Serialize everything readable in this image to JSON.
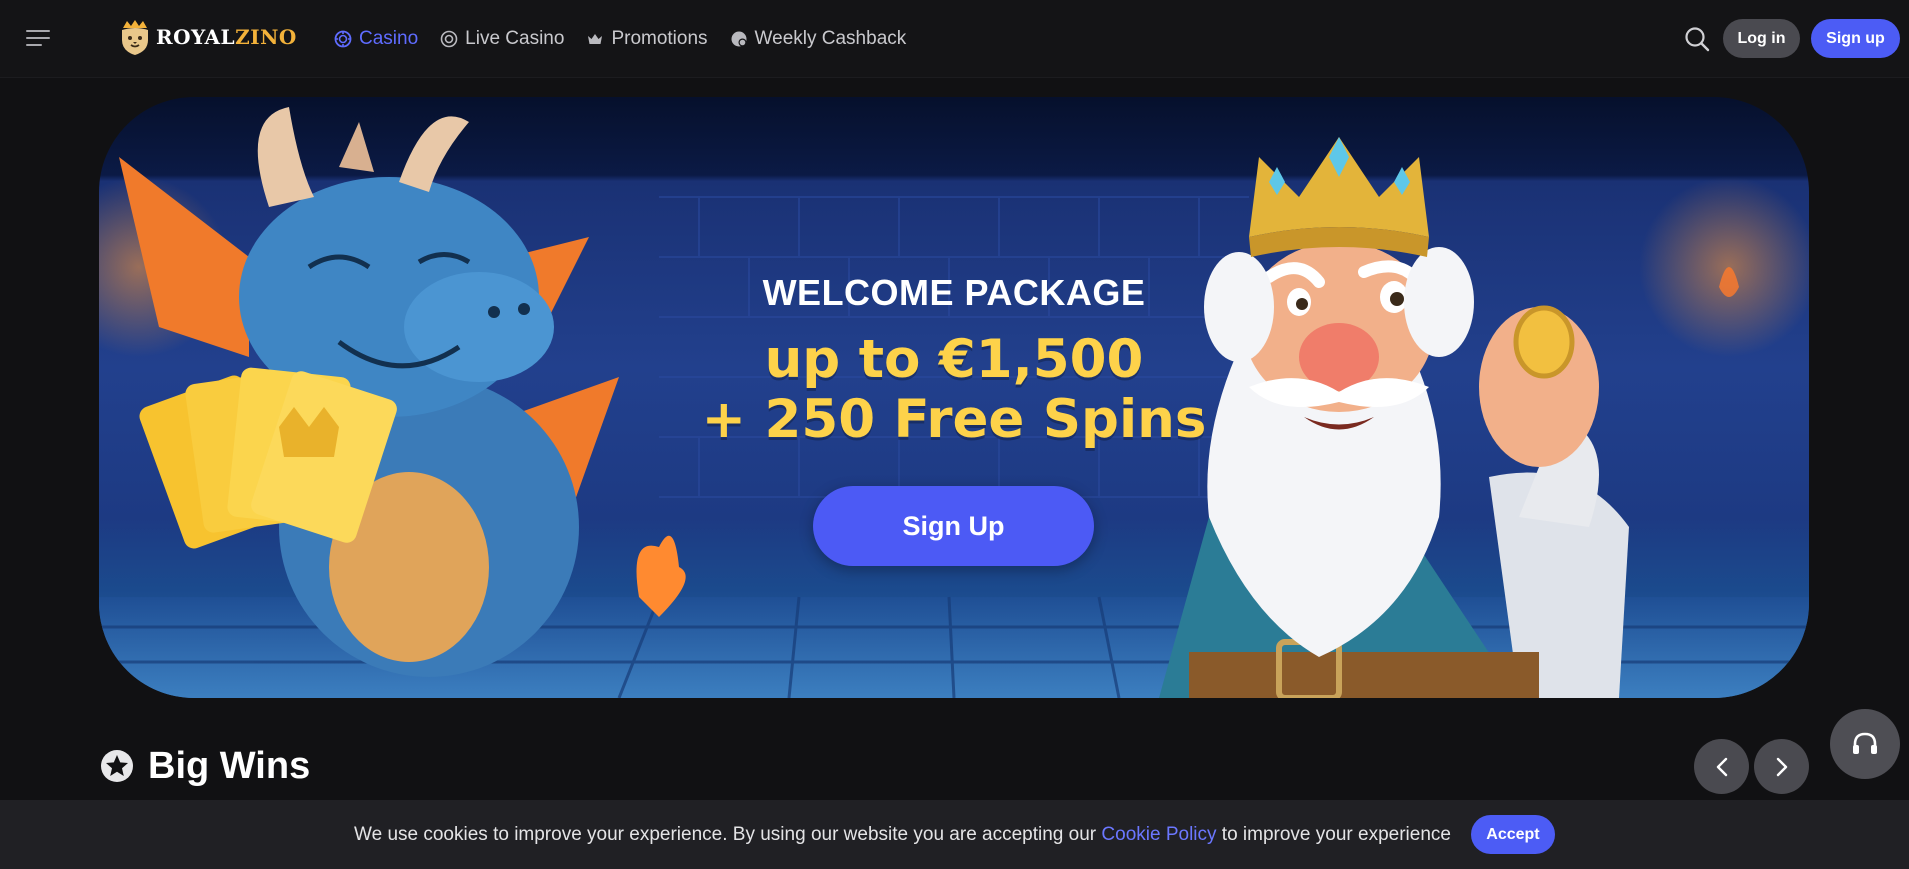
{
  "brand": {
    "name_part1": "ROYAL",
    "name_part2": "ZINO",
    "gold": "#f3b23a"
  },
  "header": {
    "nav": [
      {
        "label": "Casino",
        "icon": "casino-chip-icon",
        "active": true
      },
      {
        "label": "Live Casino",
        "icon": "live-icon",
        "active": false
      },
      {
        "label": "Promotions",
        "icon": "crown-icon",
        "active": false
      },
      {
        "label": "Weekly Cashback",
        "icon": "cashback-icon",
        "active": false
      }
    ],
    "login_label": "Log in",
    "signup_label": "Sign up"
  },
  "hero": {
    "title": "WELCOME PACKAGE",
    "line1": "up to €1,500",
    "line2": "+ 250 Free Spins",
    "cta_label": "Sign Up"
  },
  "big_wins": {
    "title": "Big Wins"
  },
  "cookie": {
    "text_before": "We use cookies to improve your experience. By using our website you are accepting our",
    "link_label": "Cookie Policy",
    "text_after": "to improve your experience",
    "accept_label": "Accept"
  },
  "colors": {
    "accent": "#4c5cf5",
    "active_nav": "#5f6cff",
    "promo_yellow": "#fdd24a",
    "background": "#111113"
  }
}
